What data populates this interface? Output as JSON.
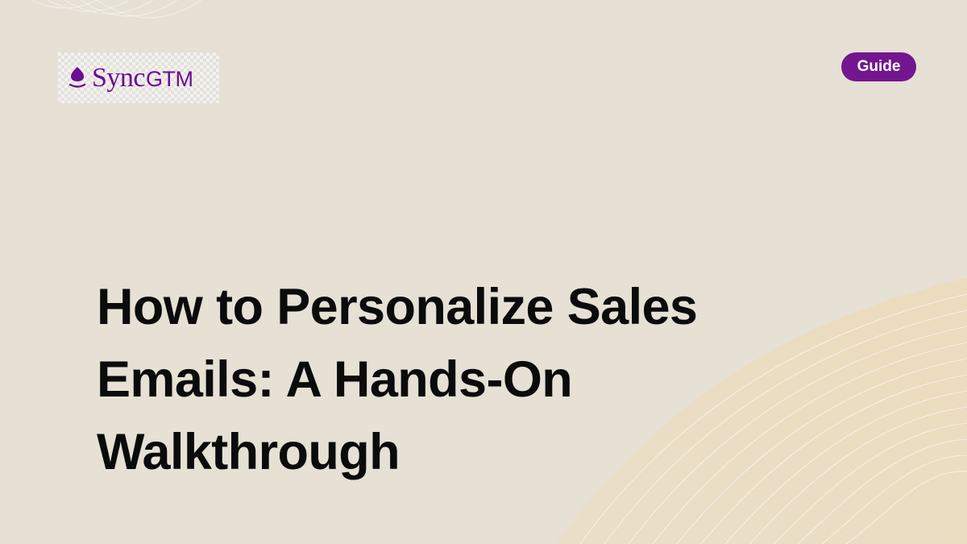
{
  "brand": {
    "logo_alt": "SyncGTM",
    "logo_sync": "Sync",
    "logo_gtm": "GTM",
    "icon": "drop-chat-icon",
    "color": "#6b0e8f"
  },
  "badge": {
    "label": "Guide",
    "color": "#74168f"
  },
  "headline": {
    "lines": [
      "How to Personalize Sales",
      "Emails: A Hands-On",
      "Walkthrough"
    ]
  },
  "colors": {
    "background": "#e6e0d5",
    "text": "#0b0b0b",
    "accent_wave": "#e9dcc2"
  }
}
